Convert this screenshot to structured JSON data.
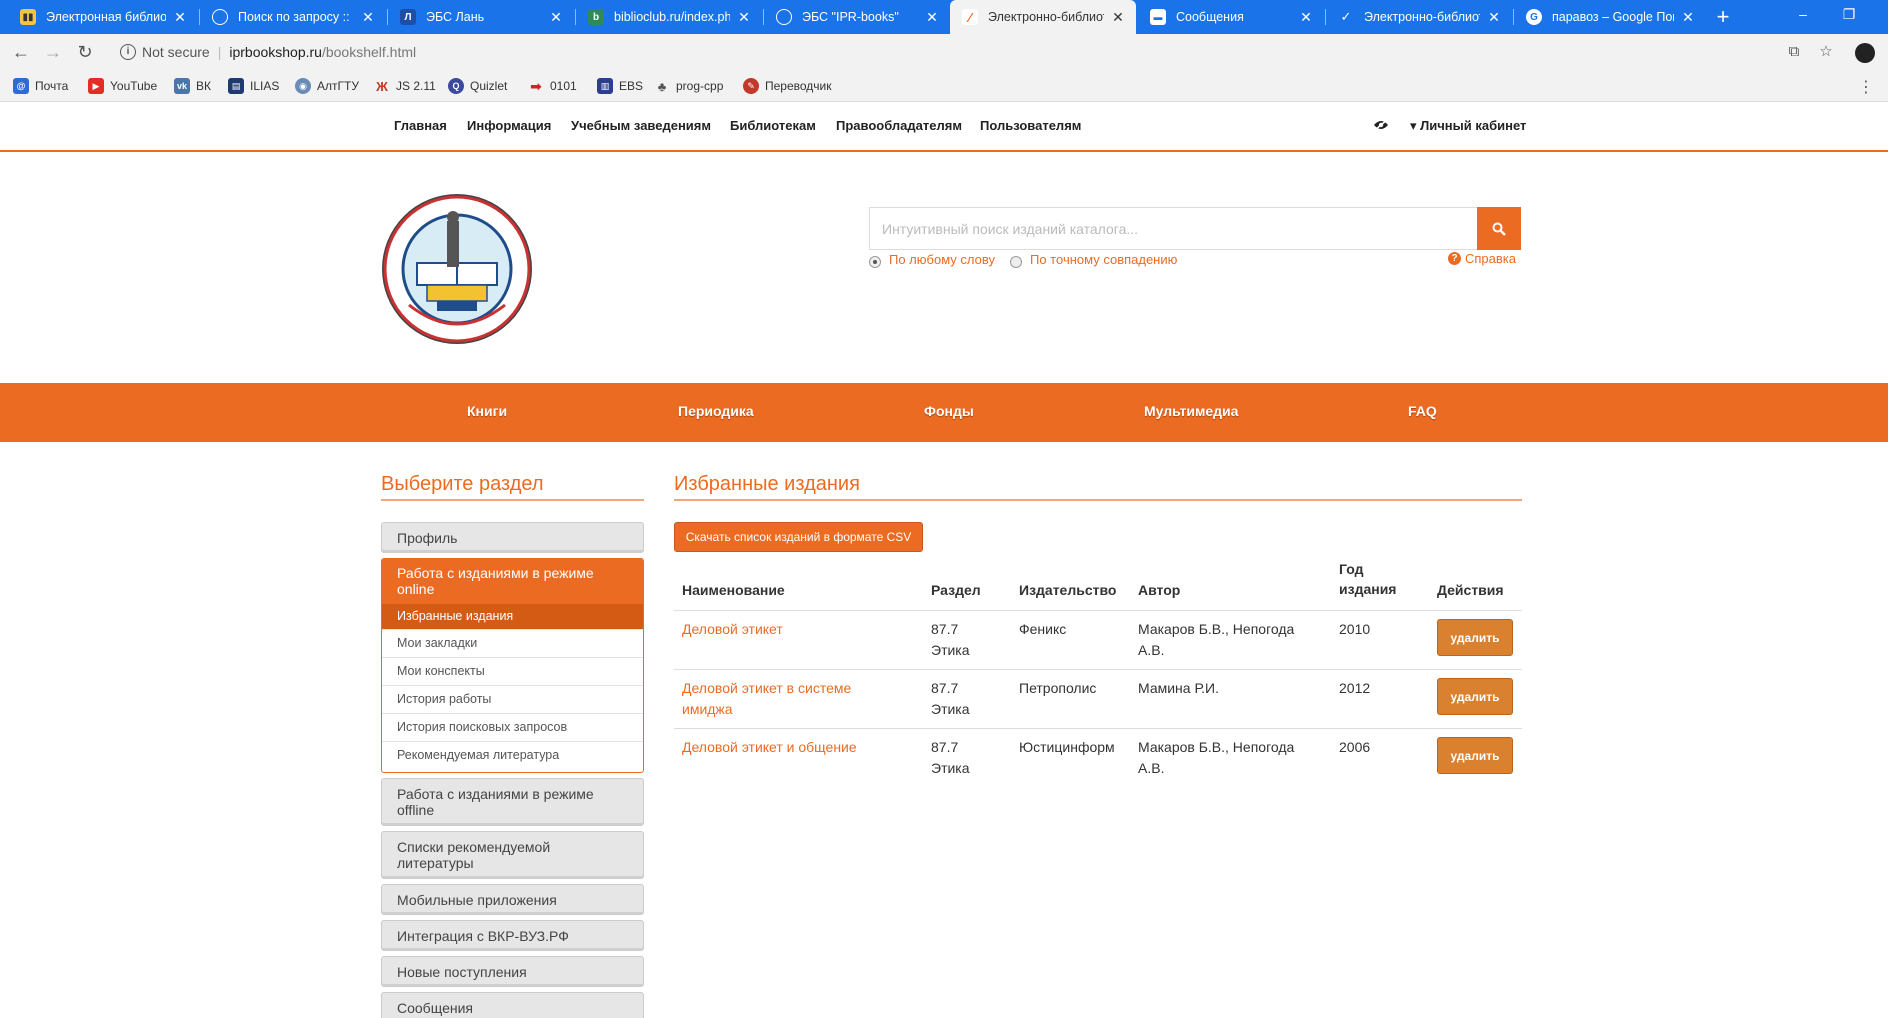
{
  "browser": {
    "tabs": [
      {
        "title": "Электронная библиот",
        "icon": "library-favicon",
        "active": false
      },
      {
        "title": "Поиск по запросу :: Ка",
        "icon": "globe-favicon",
        "active": false
      },
      {
        "title": "ЭБС Лань",
        "icon": "lan-favicon",
        "active": false
      },
      {
        "title": "biblioclub.ru/index.php",
        "icon": "biblioclub-favicon",
        "active": false
      },
      {
        "title": "ЭБС \"IPR-books\"",
        "icon": "globe-favicon",
        "active": false
      },
      {
        "title": "Электронно-библиоте",
        "icon": "iprbooks-favicon",
        "active": true
      },
      {
        "title": "Сообщения",
        "icon": "messages-favicon",
        "active": false
      },
      {
        "title": "Электронно-библиоте",
        "icon": "vk-favicon",
        "active": false
      },
      {
        "title": "паравоз – Google Пои",
        "icon": "google-favicon",
        "active": false
      }
    ],
    "address": {
      "security": "Not secure",
      "domain": "iprbookshop.ru",
      "path": "/bookshelf.html"
    },
    "bookmarks": [
      {
        "label": "Почта",
        "icon": "mail-icon",
        "color": "#2e6bd6"
      },
      {
        "label": "YouTube",
        "icon": "youtube-icon",
        "color": "#e52d27"
      },
      {
        "label": "ВК",
        "icon": "vk-icon",
        "color": "#4a76a8"
      },
      {
        "label": "ILIAS",
        "icon": "ilias-icon",
        "color": "#1f3a6e"
      },
      {
        "label": "АлтГТУ",
        "icon": "altgtu-icon",
        "color": "#6a8bb3"
      },
      {
        "label": "JS 2.11",
        "icon": "js-icon",
        "color": "#c0392b"
      },
      {
        "label": "Quizlet",
        "icon": "quizlet-icon",
        "color": "#3b4aa0"
      },
      {
        "label": "0101",
        "icon": "arrow-icon",
        "color": "#d42020"
      },
      {
        "label": "EBS",
        "icon": "ebs-icon",
        "color": "#2c3e8f"
      },
      {
        "label": "prog-cpp",
        "icon": "prog-icon",
        "color": "#555555"
      },
      {
        "label": "Переводчик",
        "icon": "translate-icon",
        "color": "#c0392b"
      }
    ]
  },
  "topnav": {
    "items": [
      "Главная",
      "Информация",
      "Учебным заведениям",
      "Библиотекам",
      "Правообладателям",
      "Пользователям"
    ],
    "cabinet": "▾ Личный кабинет"
  },
  "search": {
    "placeholder": "Интуитивный поиск изданий каталога...",
    "option_any": "По любому слову",
    "option_exact": "По точному совпадению",
    "help": "Справка"
  },
  "mainmenu": [
    "Книги",
    "Периодика",
    "Фонды",
    "Мультимедиа",
    "FAQ"
  ],
  "sidebar": {
    "title": "Выберите раздел",
    "profile": "Профиль",
    "online_group": {
      "label": "Работа с изданиями в режиме online",
      "items": [
        "Избранные издания",
        "Мои закладки",
        "Мои конспекты",
        "История работы",
        "История поисковых запросов",
        "Рекомендуемая литература"
      ]
    },
    "offline": "Работа с изданиями в режиме offline",
    "recommended_lists": "Списки рекомендуемой литературы",
    "mobile": "Мобильные приложения",
    "integration": "Интеграция с ВКР-ВУЗ.РФ",
    "new_arrivals": "Новые поступления",
    "messages": "Сообщения"
  },
  "main": {
    "title": "Избранные издания",
    "csv_button": "Скачать список изданий в формате CSV",
    "headers": {
      "name": "Наименование",
      "section": "Раздел",
      "publisher": "Издательство",
      "author": "Автор",
      "year": "Год издания",
      "actions": "Действия"
    },
    "rows": [
      {
        "name": "Деловой этикет",
        "section": "87.7 Этика",
        "publisher": "Феникс",
        "author": "Макаров Б.В., Непогода А.В.",
        "year": "2010",
        "action": "удалить"
      },
      {
        "name": "Деловой этикет в системе имиджа",
        "section": "87.7 Этика",
        "publisher": "Петрополис",
        "author": "Мамина Р.И.",
        "year": "2012",
        "action": "удалить"
      },
      {
        "name": "Деловой этикет и общение",
        "section": "87.7 Этика",
        "publisher": "Юстицинформ",
        "author": "Макаров Б.В., Непогода А.В.",
        "year": "2006",
        "action": "удалить"
      }
    ]
  },
  "colors": {
    "accent": "#ec6b22",
    "chrome_tabbar": "#1a73e8",
    "delete_button": "#d9812e"
  }
}
